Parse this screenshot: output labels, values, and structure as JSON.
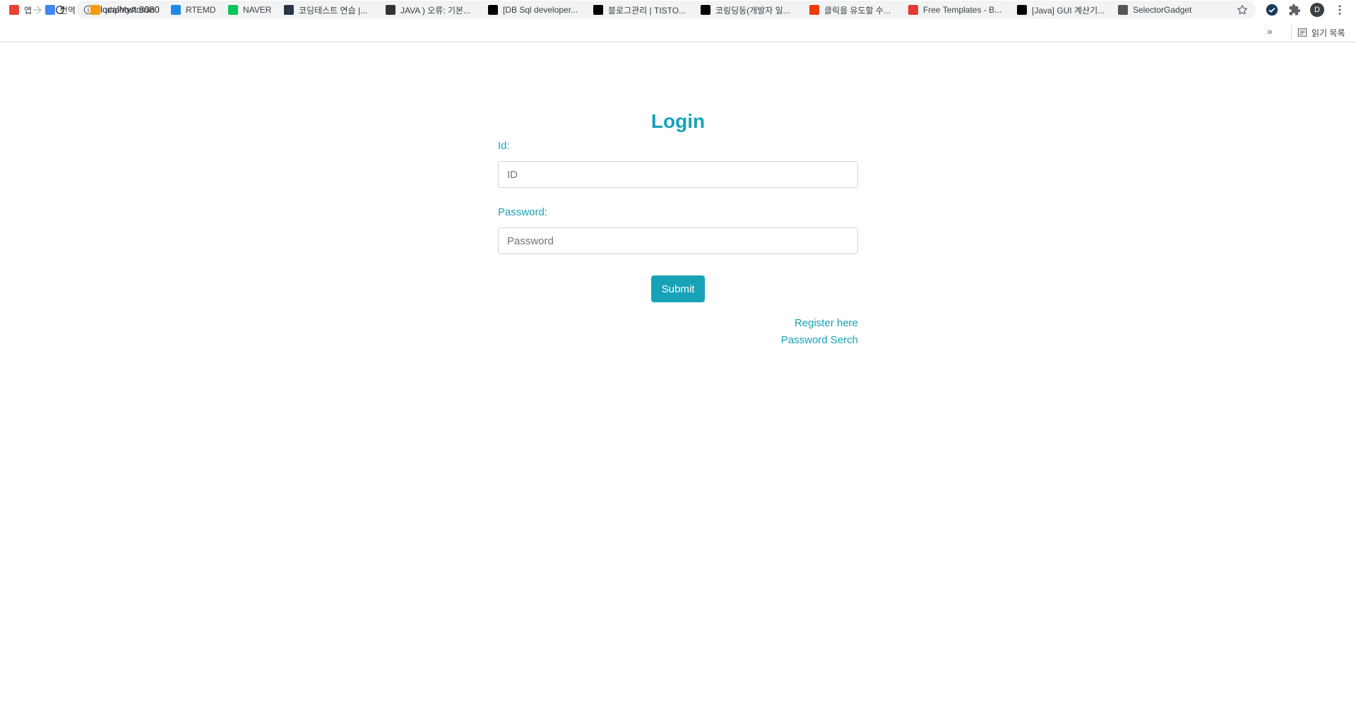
{
  "browser": {
    "url": "localhost:8080",
    "avatar_letter": "D",
    "bookmarks": [
      {
        "label": "앱",
        "icon": "apps-grid-icon",
        "color": "#ea4335"
      },
      {
        "label": "번역",
        "icon": "google-translate-icon",
        "color": "#4285f4"
      },
      {
        "label": "phpMyAdmin",
        "icon": "phpmyadmin-icon",
        "color": "#f89c0e"
      },
      {
        "label": "RTEMD",
        "icon": "rtemd-icon",
        "color": "#1e88e5"
      },
      {
        "label": "NAVER",
        "icon": "naver-icon",
        "color": "#03c75a"
      },
      {
        "label": "코딩테스트 연습 |...",
        "icon": "programmers-icon",
        "color": "#263747"
      },
      {
        "label": "JAVA ) 오류: 기본...",
        "icon": "keyboard-icon",
        "color": "#333333"
      },
      {
        "label": "[DB Sql developer...",
        "icon": "tistory-icon",
        "color": "#000000"
      },
      {
        "label": "블로그관리 | TISTO...",
        "icon": "tistory-icon",
        "color": "#000000"
      },
      {
        "label": "코링딩동(개발자 일...",
        "icon": "tistory-icon",
        "color": "#000000"
      },
      {
        "label": "클릭을 유도할 수...",
        "icon": "office-icon",
        "color": "#eb3c00"
      },
      {
        "label": "Free Templates - B...",
        "icon": "template-icon",
        "color": "#e53935"
      },
      {
        "label": "[Java] GUI 계산기...",
        "icon": "tistory-icon",
        "color": "#000000"
      },
      {
        "label": "SelectorGadget",
        "icon": "selectorgadget-icon",
        "color": "#555555"
      }
    ],
    "more_label": "»",
    "reading_list_label": "읽기 목록"
  },
  "login": {
    "title": "Login",
    "id_label": "Id:",
    "id_placeholder": "ID",
    "id_value": "",
    "password_label": "Password:",
    "password_placeholder": "Password",
    "password_value": "",
    "submit_label": "Submit",
    "register_link": "Register here",
    "password_search_link": "Password Serch"
  },
  "colors": {
    "accent": "#17a2b8",
    "input_border": "#ced4da"
  }
}
